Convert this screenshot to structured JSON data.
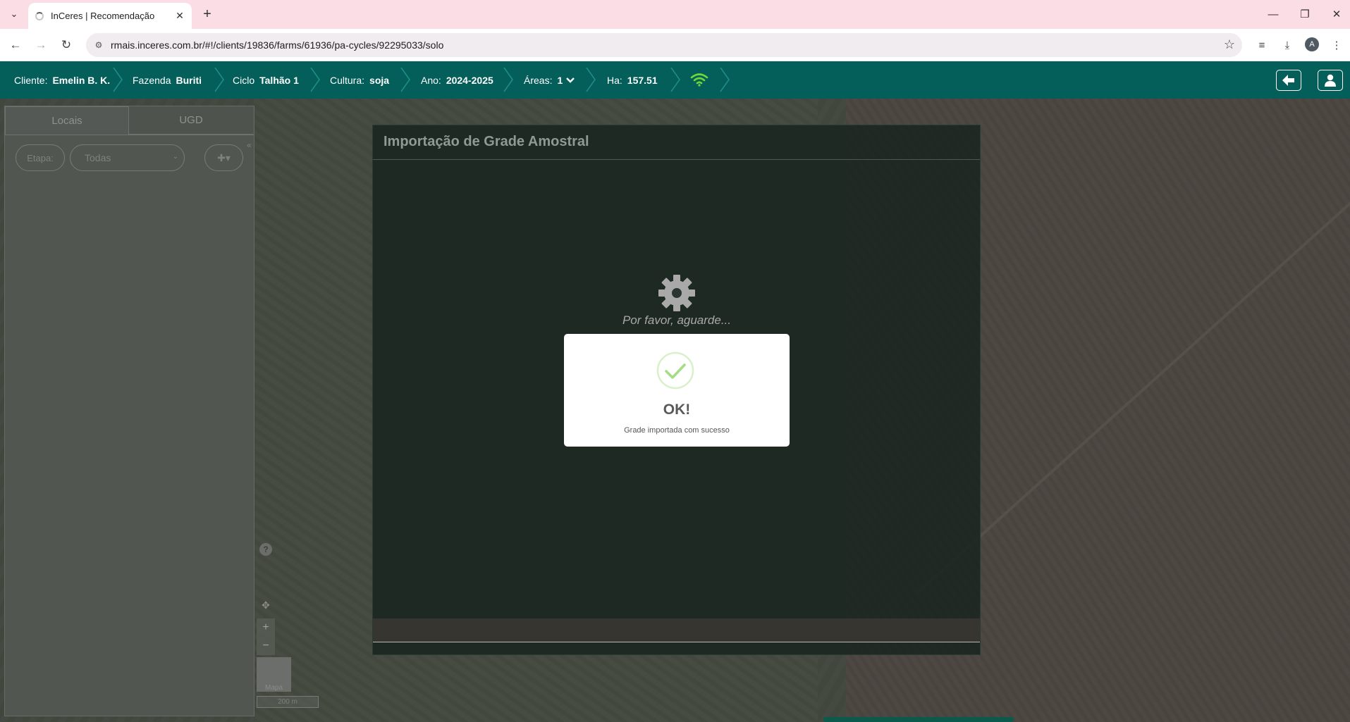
{
  "browser": {
    "tab_title": "InCeres | Recomendação",
    "url": "rmais.inceres.com.br/#!/clients/19836/farms/61936/pa-cycles/92295033/solo",
    "profile_initial": "A"
  },
  "header": {
    "cliente_label": "Cliente:",
    "cliente_value": "Emelin B. K.",
    "fazenda_label": "Fazenda",
    "fazenda_value": "Buriti",
    "ciclo_label": "Ciclo",
    "ciclo_value": "Talhão 1",
    "cultura_label": "Cultura:",
    "cultura_value": "soja",
    "ano_label": "Ano:",
    "ano_value": "2024-2025",
    "areas_label": "Áreas:",
    "areas_value": "1",
    "ha_label": "Ha:",
    "ha_value": "157.51",
    "accent_color": "#045f5b",
    "wifi_color": "#6fd63a"
  },
  "sidepanel": {
    "tabs": [
      "Locais",
      "UGD"
    ],
    "etapa_label": "Etapa:",
    "etapa_select_value": "Todas",
    "add_button_label": "✚▾"
  },
  "map": {
    "help_label": "?",
    "zoom_in_label": "+",
    "zoom_out_label": "−",
    "thumbnail_label": "Mapa",
    "scale_label": "200 m"
  },
  "modal": {
    "title": "Importação de Grade Amostral",
    "loading_text": "Por favor, aguarde..."
  },
  "alert": {
    "title": "OK!",
    "message": "Grade importada com sucesso",
    "success_color": "#a5dc86"
  }
}
